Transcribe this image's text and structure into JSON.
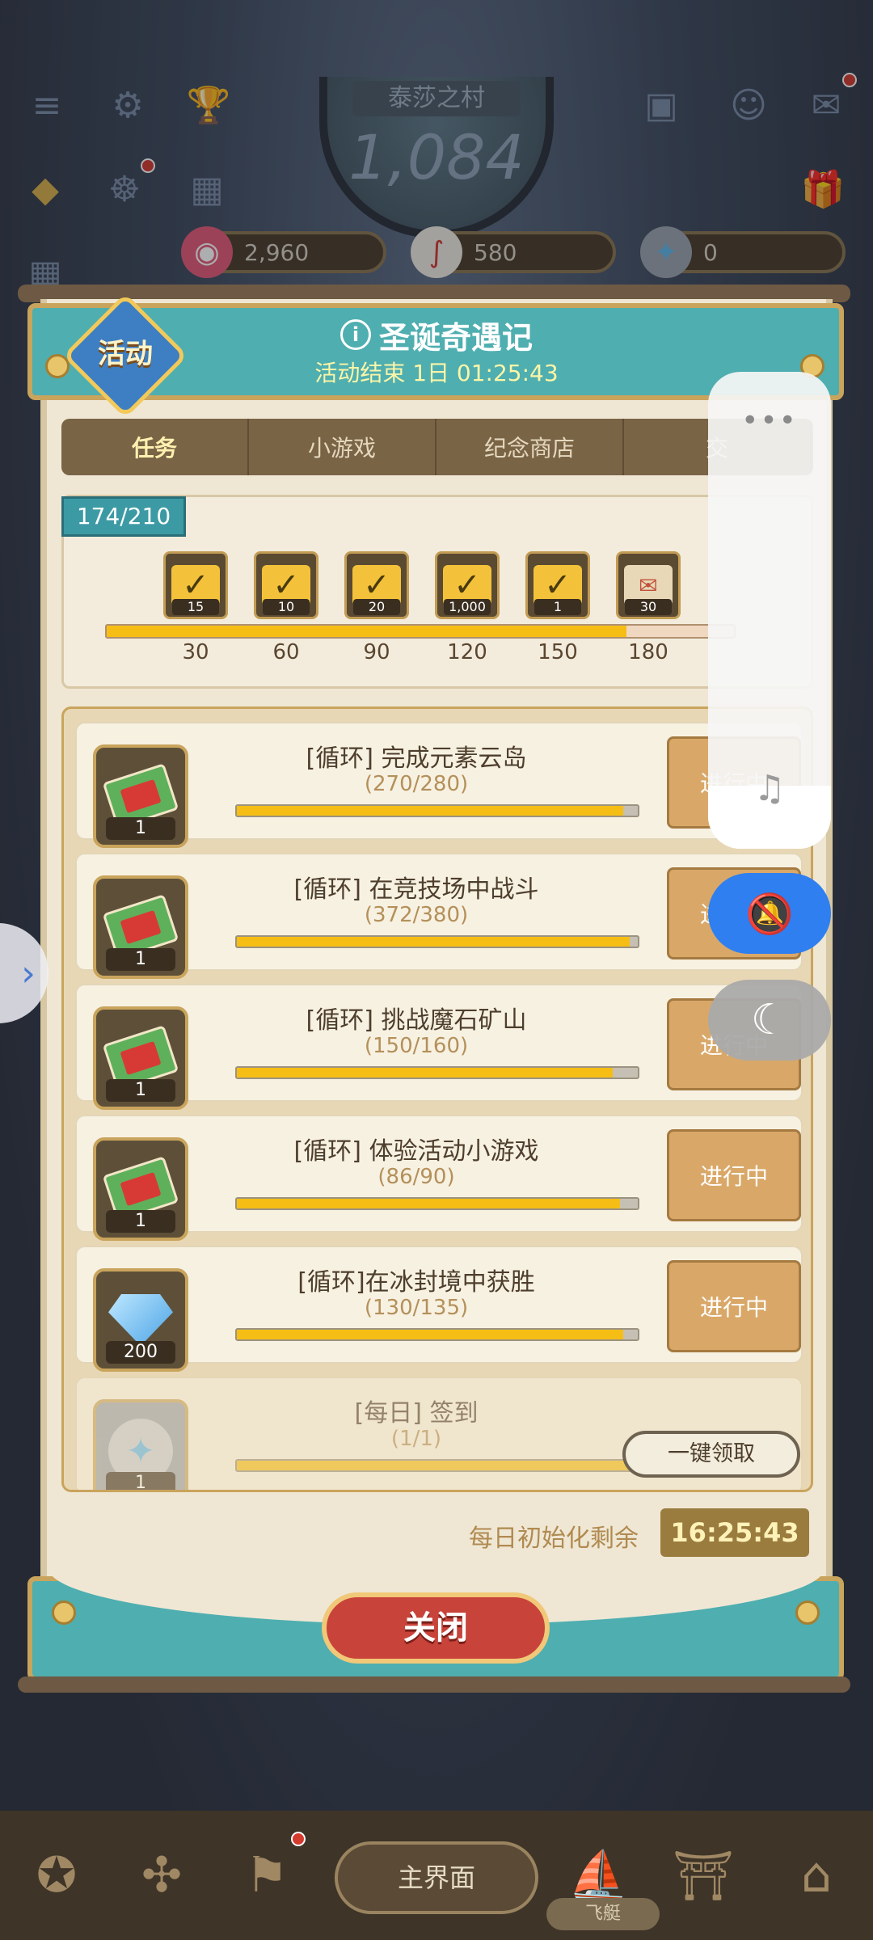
{
  "top_bar": {
    "village_name": "泰莎之村",
    "level": "1,084",
    "currencies": [
      {
        "name": "candy-icon",
        "value": "2,960",
        "color": "#e45a78"
      },
      {
        "name": "candy-cane-icon",
        "value": "580",
        "color": "#ffffff"
      },
      {
        "name": "star-coin-icon",
        "value": "0",
        "color": "#5fb6e8"
      }
    ]
  },
  "event": {
    "badge": "活动",
    "title": "圣诞奇遇记",
    "timer": "活动结束 1日 01:25:43"
  },
  "tabs": [
    "任务",
    "小游戏",
    "纪念商店",
    "交"
  ],
  "milestones": {
    "progress": "174/210",
    "progress_fraction": 0.829,
    "items": [
      {
        "qty": "15",
        "label": "30"
      },
      {
        "qty": "10",
        "label": "60"
      },
      {
        "qty": "20",
        "label": "90"
      },
      {
        "qty": "1,000",
        "label": "120"
      },
      {
        "qty": "1",
        "label": "150"
      },
      {
        "qty": "30",
        "label": "180"
      }
    ]
  },
  "tasks": [
    {
      "title": "[循环] 完成元素云岛",
      "count": "(270/280)",
      "progress": 0.964,
      "reward_qty": "1",
      "reward": "ticket-icon",
      "button": "进行中"
    },
    {
      "title": "[循环] 在竞技场中战斗",
      "count": "(372/380)",
      "progress": 0.979,
      "reward_qty": "1",
      "reward": "ticket-icon",
      "button": "进行中"
    },
    {
      "title": "[循环] 挑战魔石矿山",
      "count": "(150/160)",
      "progress": 0.9375,
      "reward_qty": "1",
      "reward": "ticket-icon",
      "button": "进行中"
    },
    {
      "title": "[循环] 体验活动小游戏",
      "count": "(86/90)",
      "progress": 0.956,
      "reward_qty": "1",
      "reward": "ticket-icon",
      "button": "进行中"
    },
    {
      "title": "[循环]在冰封境中获胜",
      "count": "(130/135)",
      "progress": 0.963,
      "reward_qty": "200",
      "reward": "gem-icon",
      "button": "进行中"
    },
    {
      "title": "[每日] 签到",
      "count": "(1/1)",
      "progress": 1.0,
      "reward_qty": "1",
      "reward": "star-coin-icon",
      "button": ""
    }
  ],
  "claim_all": "一键领取",
  "daily_reset": {
    "label": "每日初始化剩余",
    "time": "16:25:43"
  },
  "close_button": "关闭",
  "bottom_bar": {
    "main_screen": "主界面",
    "airship": "飞艇"
  }
}
